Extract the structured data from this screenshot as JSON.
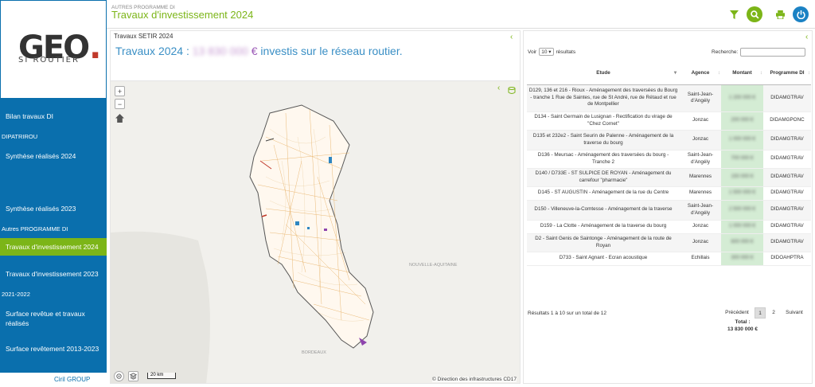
{
  "sidebar": {
    "logo_text": "GEO.",
    "logo_sub": "SI ROUTIER",
    "items": [
      {
        "label": "Bilan travaux DI"
      },
      {
        "label": "Synthèse réalisés 2024"
      },
      {
        "label": "Synthèse réalisés 2023"
      },
      {
        "label": "Travaux d'investissement 2024"
      },
      {
        "label": "Travaux d'investissement 2023"
      },
      {
        "label": "Surface revêtue et travaux réalisés"
      },
      {
        "label": "Surface revêtement 2013-2023"
      }
    ],
    "sections": [
      "DIPATRIROU",
      "Autres PROGRAMME DI",
      "2021-2022"
    ],
    "footer": "Ciril GROUP"
  },
  "header": {
    "subtitle": "AUTRES PROGRAMME DI",
    "title": "Travaux d'investissement 2024"
  },
  "left_panel": {
    "title": "Travaux SETIR 2024",
    "headline_prefix": "Travaux 2024 : ",
    "headline_amount": "13 830 000",
    "headline_currency": "€",
    "headline_suffix": " investis sur le réseau routier.",
    "map": {
      "zoom_in": "+",
      "zoom_out": "−",
      "scale": "20 km",
      "attribution": "© Direction des infrastructures CD17",
      "labels": [
        "NOUVELLE-AQUITAINE",
        "BORDEAUX"
      ]
    }
  },
  "table": {
    "voir_label": "Voir",
    "page_size": "10",
    "resultats_label": "résultats",
    "search_label": "Recherche:",
    "columns": [
      "Etude",
      "Agence",
      "Montant",
      "Programme DI"
    ],
    "rows": [
      {
        "etude": "D129, 136 et 216 - Rioux - Aménagement des traversées du Bourg - tranche 1 Rue de Saintes, rue de St André, rue de Rétaud et rue de Montpellier",
        "agence": "Saint-Jean-d'Angély",
        "montant": "1 200 000 €",
        "programme": "DIDAMGTRAV"
      },
      {
        "etude": "D134 - Saint Germain de Lusignan - Rectification du virage de \"Chez Cornet\"",
        "agence": "Jonzac",
        "montant": "200 000 €",
        "programme": "DIDAMGPONC"
      },
      {
        "etude": "D135 et 232e2 - Saint Seurin de Palenne - Aménagement de la traverse du bourg",
        "agence": "Jonzac",
        "montant": "1 000 000 €",
        "programme": "DIDAMGTRAV"
      },
      {
        "etude": "D136 - Meursac - Aménagement des traversées du bourg - Tranche 2",
        "agence": "Saint-Jean-d'Angély",
        "montant": "700 000 €",
        "programme": "DIDAMGTRAV"
      },
      {
        "etude": "D140 / D733E - ST SULPICE DE ROYAN - Aménagement du carrefour \"pharmacie\"",
        "agence": "Marennes",
        "montant": "150 000 €",
        "programme": "DIDAMGTRAV"
      },
      {
        "etude": "D145 - ST AUGUSTIN - Aménagement de la rue du Centre",
        "agence": "Marennes",
        "montant": "1 500 000 €",
        "programme": "DIDAMGTRAV"
      },
      {
        "etude": "D150 - Villeneuve-la-Comtesse - Aménagement de la traverse",
        "agence": "Saint-Jean-d'Angély",
        "montant": "2 500 000 €",
        "programme": "DIDAMGTRAV"
      },
      {
        "etude": "D159 - La Clotte - Aménagement de la traverse du bourg",
        "agence": "Jonzac",
        "montant": "1 000 000 €",
        "programme": "DIDAMGTRAV"
      },
      {
        "etude": "D2 - Saint Genis de Saintonge - Aménagement de la route de Royan",
        "agence": "Jonzac",
        "montant": "600 000 €",
        "programme": "DIDAMGTRAV"
      },
      {
        "etude": "D733 - Saint Agnant - Ecran acoustique",
        "agence": "Echillais",
        "montant": "300 000 €",
        "programme": "DIDOAHPTRA"
      }
    ],
    "total_label": "Total :",
    "total_value": "13 830 000 €",
    "info": "Résultats 1 à 10 sur un total de 12",
    "pager": {
      "prev": "Précédent",
      "pages": [
        "1",
        "2"
      ],
      "next": "Suivant"
    }
  },
  "colors": {
    "sidebar": "#0a6fad",
    "active": "#7cb518",
    "accent_green": "#7cb518",
    "headline_blue": "#3a8fc5",
    "amount_purple": "#9b59b6"
  }
}
